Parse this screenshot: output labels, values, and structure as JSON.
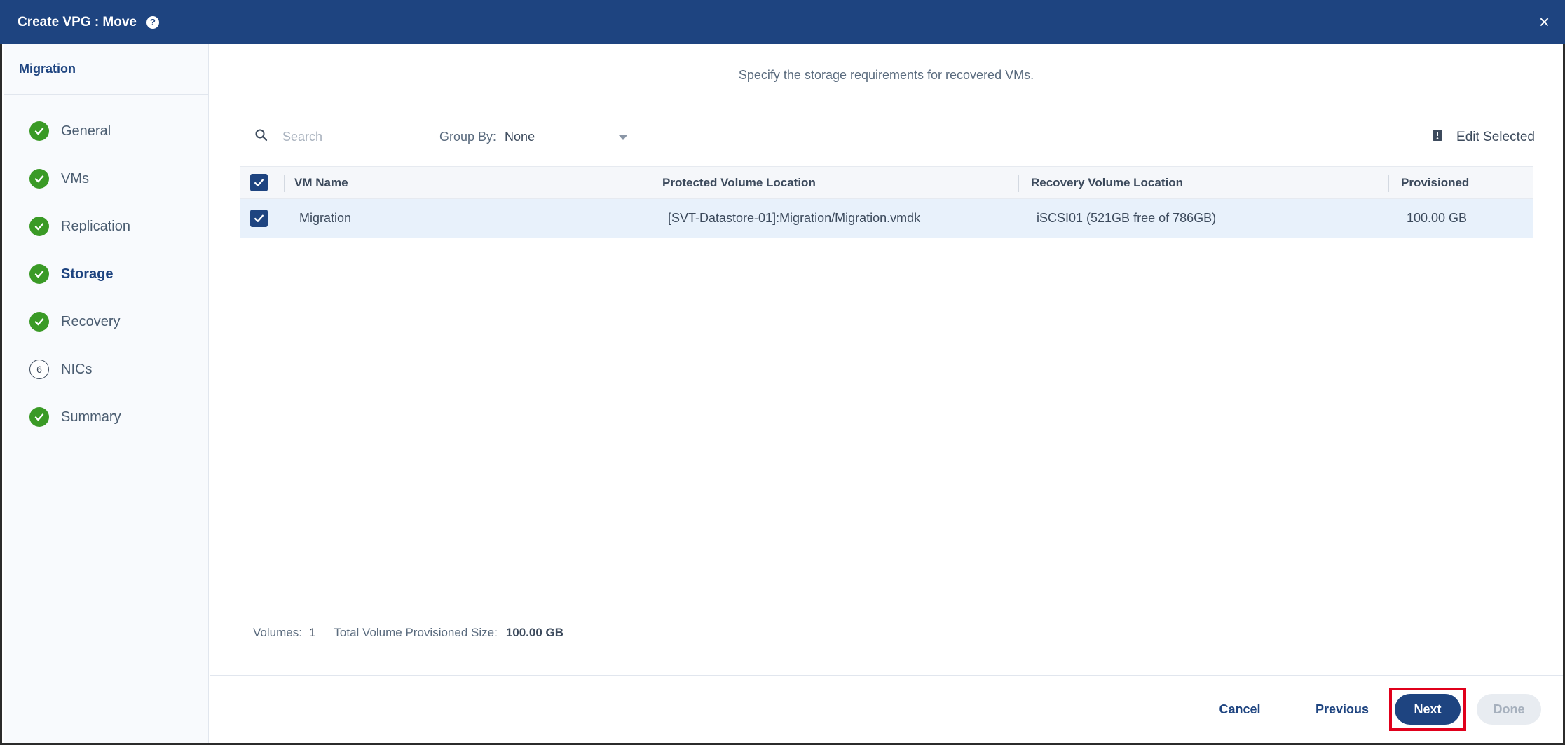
{
  "dialog": {
    "title": "Create VPG : Move",
    "help_icon": "?",
    "close_icon": "×"
  },
  "sidebar": {
    "header": "Migration",
    "steps": [
      {
        "label": "General",
        "status": "complete"
      },
      {
        "label": "VMs",
        "status": "complete"
      },
      {
        "label": "Replication",
        "status": "complete"
      },
      {
        "label": "Storage",
        "status": "complete",
        "active": true
      },
      {
        "label": "Recovery",
        "status": "complete"
      },
      {
        "label": "NICs",
        "status": "pending",
        "number": "6"
      },
      {
        "label": "Summary",
        "status": "complete"
      }
    ]
  },
  "main": {
    "subtitle": "Specify the storage requirements for recovered VMs.",
    "search": {
      "placeholder": "Search",
      "value": ""
    },
    "group_by": {
      "label": "Group By:",
      "value": "None"
    },
    "edit_selected": "Edit Selected"
  },
  "table": {
    "columns": [
      "VM Name",
      "Protected Volume Location",
      "Recovery Volume Location",
      "Provisioned"
    ],
    "rows": [
      {
        "checked": true,
        "vm_name": "Migration",
        "protected": "[SVT-Datastore-01]:Migration/Migration.vmdk",
        "recovery": "iSCSI01 (521GB free of 786GB)",
        "provisioned": "100.00 GB"
      }
    ]
  },
  "footer": {
    "volumes_label": "Volumes:",
    "volumes_value": "1",
    "total_label": "Total Volume Provisioned Size:",
    "total_value": "100.00 GB"
  },
  "buttons": {
    "cancel": "Cancel",
    "previous": "Previous",
    "next": "Next",
    "done": "Done"
  },
  "colors": {
    "header_blue": "#1e4480",
    "step_green": "#3a9a26",
    "row_selected": "#e8f1fb",
    "highlight_red": "#e0001b"
  }
}
